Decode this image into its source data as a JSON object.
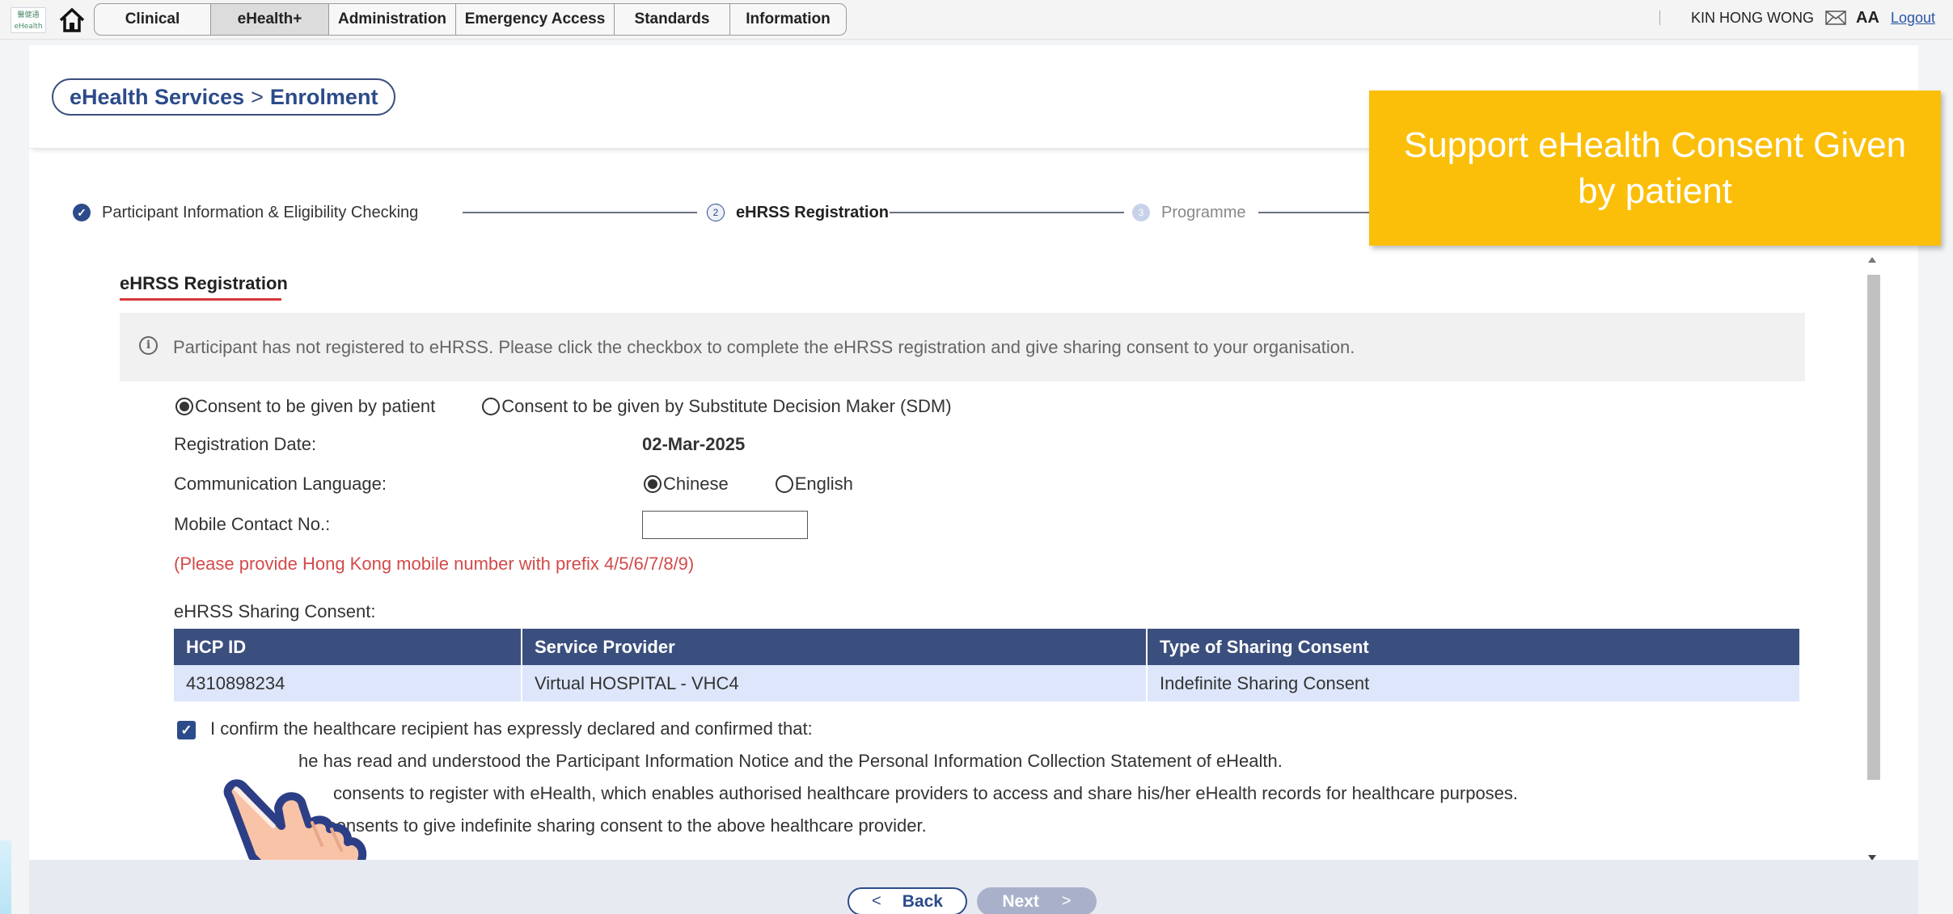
{
  "topbar": {
    "logo_text": "醫健通 eHealth",
    "tabs": [
      "Clinical",
      "eHealth+",
      "Administration",
      "Emergency Access",
      "Standards",
      "Information"
    ],
    "active_tab": "eHealth+",
    "user_name": "KIN HONG WONG",
    "font_size_label": "AA",
    "logout": "Logout"
  },
  "breadcrumb": {
    "root": "eHealth Services",
    "separator": ">",
    "current": "Enrolment"
  },
  "steps": [
    {
      "label": "Participant Information & Eligibility Checking",
      "number": "",
      "status": "done"
    },
    {
      "label": "eHRSS Registration",
      "number": "2",
      "status": "current"
    },
    {
      "label": "Programme",
      "number": "3",
      "status": "pending"
    }
  ],
  "section": {
    "title": "eHRSS Registration"
  },
  "info_message": "Participant has not registered to eHRSS. Please click the checkbox to complete the eHRSS registration and give sharing consent to your organisation.",
  "consent_options": [
    {
      "label": "Consent to be given by patient",
      "selected": true
    },
    {
      "label": "Consent to be given by Substitute Decision Maker (SDM)",
      "selected": false
    }
  ],
  "form": {
    "registration_date_label": "Registration Date:",
    "registration_date_value": "02-Mar-2025",
    "language_label": "Communication Language:",
    "language_options": [
      {
        "label": "Chinese",
        "selected": true
      },
      {
        "label": "English",
        "selected": false
      }
    ],
    "mobile_label": "Mobile Contact No.:",
    "mobile_value": "",
    "mobile_note": "(Please provide Hong Kong mobile number with prefix 4/5/6/7/8/9)",
    "sharing_label": "eHRSS Sharing Consent:"
  },
  "table": {
    "headers": [
      "HCP ID",
      "Service Provider",
      "Type of Sharing Consent"
    ],
    "rows": [
      [
        "4310898234",
        "Virtual HOSPITAL - VHC4",
        "Indefinite Sharing Consent"
      ]
    ]
  },
  "declaration": {
    "checked": true,
    "intro": "I confirm the healthcare recipient has expressly declared and confirmed that:",
    "lines": [
      "he has read and understood the Participant Information Notice and the Personal Information Collection Statement of eHealth.",
      "consents to register with eHealth, which enables authorised healthcare providers to access and share his/her eHealth records for healthcare purposes.",
      "he consents to give indefinite sharing consent to the above healthcare provider."
    ]
  },
  "buttons": {
    "back": "Back",
    "next": "Next"
  },
  "callout": {
    "text": "Support eHealth Consent Given by patient",
    "color": "#fbbf0a"
  },
  "colors": {
    "primary": "#2c4b8a",
    "table_header": "#3b4f7e",
    "table_row": "#dde6fa",
    "warning": "#d34a4a",
    "underline": "#d9383c"
  }
}
